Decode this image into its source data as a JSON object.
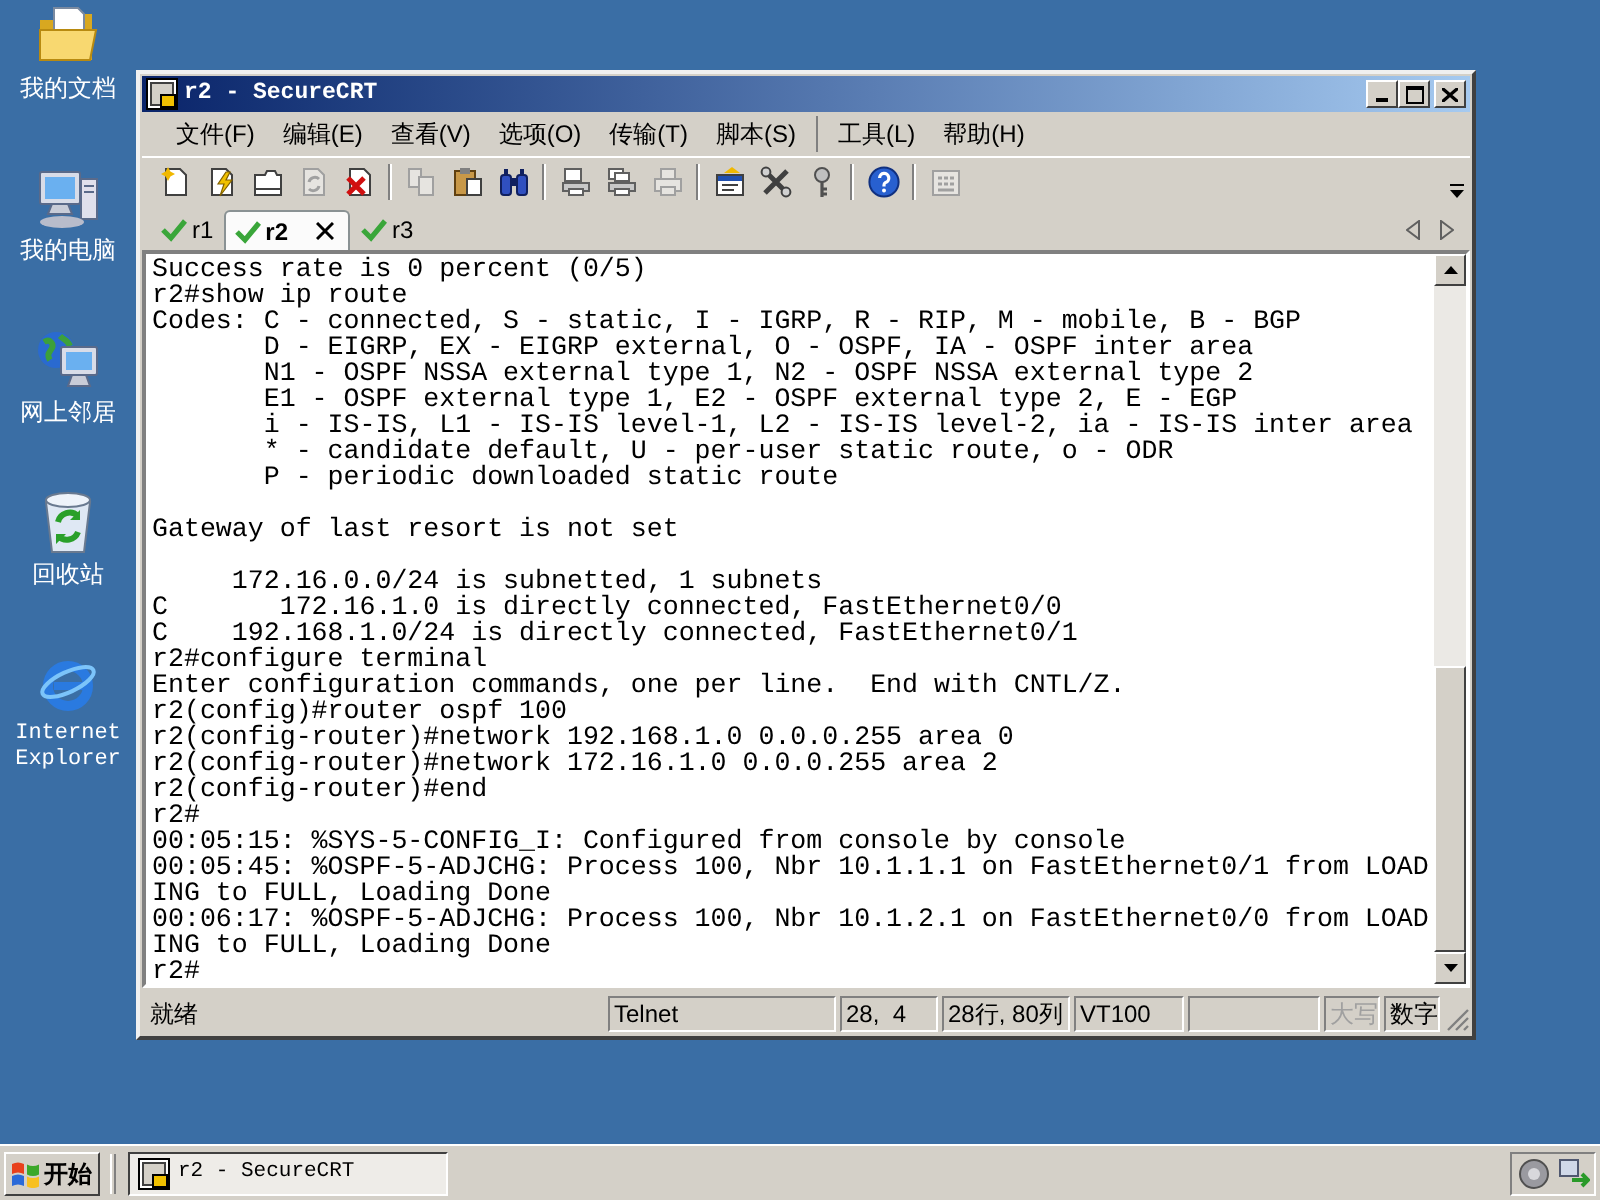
{
  "desktop": {
    "icons": [
      {
        "kind": "documents",
        "label": "我的文档"
      },
      {
        "kind": "computer",
        "label": "我的电脑"
      },
      {
        "kind": "network",
        "label": "网上邻居"
      },
      {
        "kind": "recycle_bin",
        "label": "回收站"
      },
      {
        "kind": "browser",
        "label": "Internet Explorer"
      }
    ]
  },
  "window": {
    "title": "r2 - SecureCRT",
    "active": true
  },
  "menu": [
    [
      "文件(F)",
      "编辑(E)",
      "查看(V)",
      "选项(O)",
      "传输(T)",
      "脚本(S)"
    ],
    [
      "工具(L)",
      "帮助(H)"
    ]
  ],
  "toolbar": [
    [
      {
        "kind": "new_session",
        "disabled": false
      },
      {
        "kind": "quick_connect",
        "disabled": false
      },
      {
        "kind": "connect_tab",
        "disabled": false
      },
      {
        "kind": "reconnect",
        "disabled": true
      },
      {
        "kind": "disconnect",
        "disabled": false
      }
    ],
    [
      {
        "kind": "copy",
        "disabled": true
      },
      {
        "kind": "paste",
        "disabled": false
      },
      {
        "kind": "find",
        "disabled": false
      }
    ],
    [
      {
        "kind": "print_setup",
        "disabled": false
      },
      {
        "kind": "print_selection",
        "disabled": false
      },
      {
        "kind": "print",
        "disabled": true
      }
    ],
    [
      {
        "kind": "session_options",
        "disabled": false
      },
      {
        "kind": "global_options",
        "disabled": false
      },
      {
        "kind": "keymap",
        "disabled": false
      }
    ],
    [
      {
        "kind": "help",
        "disabled": false
      }
    ],
    [
      {
        "kind": "keymap_editor",
        "disabled": true
      }
    ]
  ],
  "tabs": [
    {
      "label": "r1",
      "selected": false
    },
    {
      "label": "r2",
      "selected": true
    },
    {
      "label": "r3",
      "selected": false
    }
  ],
  "terminal": {
    "blocks": [
      [
        "Success rate is 0 percent (0/5)",
        "r2#show ip route",
        "Codes: C - connected, S - static, I - IGRP, R - RIP, M - mobile, B - BGP",
        "       D - EIGRP, EX - EIGRP external, O - OSPF, IA - OSPF inter area",
        "       N1 - OSPF NSSA external type 1, N2 - OSPF NSSA external type 2",
        "       E1 - OSPF external type 1, E2 - OSPF external type 2, E - EGP",
        "       i - IS-IS, L1 - IS-IS level-1, L2 - IS-IS level-2, ia - IS-IS inter area",
        "       * - candidate default, U - per-user static route, o - ODR",
        "       P - periodic downloaded static route"
      ],
      [
        "Gateway of last resort is not set"
      ],
      [
        "     172.16.0.0/24 is subnetted, 1 subnets",
        "C       172.16.1.0 is directly connected, FastEthernet0/0",
        "C    192.168.1.0/24 is directly connected, FastEthernet0/1",
        "r2#configure terminal",
        "Enter configuration commands, one per line.  End with CNTL/Z.",
        "r2(config)#router ospf 100",
        "r2(config-router)#network 192.168.1.0 0.0.0.255 area 0",
        "r2(config-router)#network 172.16.1.0 0.0.0.255 area 2",
        "r2(config-router)#end",
        "r2#",
        "00:05:15: %SYS-5-CONFIG_I: Configured from console by console",
        "00:05:45: %OSPF-5-ADJCHG: Process 100, Nbr 10.1.1.1 on FastEthernet0/1 from LOAD",
        "ING to FULL, Loading Done",
        "00:06:17: %OSPF-5-ADJCHG: Process 100, Nbr 10.1.2.1 on FastEthernet0/0 from LOAD",
        "ING to FULL, Loading Done",
        "r2#"
      ]
    ]
  },
  "status_bar": {
    "message": "就绪",
    "panes": [
      {
        "kind": "text",
        "text": "Telnet",
        "disabled": false
      },
      {
        "kind": "text",
        "text": "28,  4",
        "disabled": false
      },
      {
        "kind": "text",
        "text": "28行, 80列",
        "disabled": false
      },
      {
        "kind": "text",
        "text": "VT100",
        "disabled": false
      },
      {
        "kind": "empty"
      },
      {
        "kind": "text",
        "text": "大写",
        "disabled": true
      },
      {
        "kind": "text",
        "text": "数字",
        "disabled": false
      }
    ]
  },
  "taskbar": {
    "start": "开始",
    "tasks": [
      {
        "label": "r2 - SecureCRT",
        "selected": true
      }
    ]
  }
}
